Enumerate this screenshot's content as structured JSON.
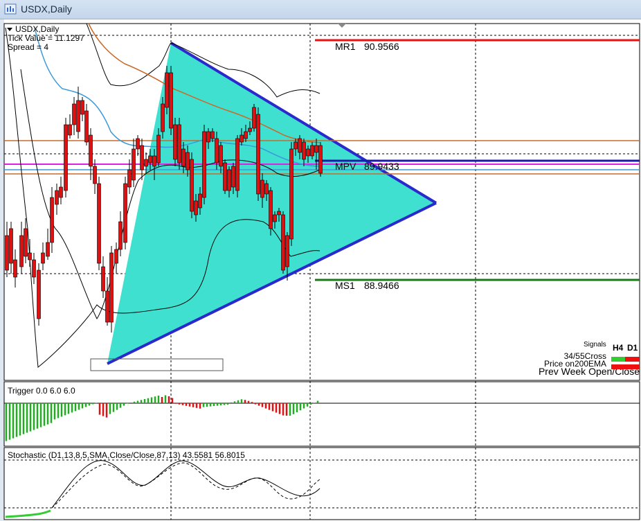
{
  "window": {
    "title": "USDX,Daily",
    "icon": "chart-window-icon"
  },
  "main_panel": {
    "header": {
      "symbol": "USDX,Daily",
      "tick_value": "Tick Value = 11.1297",
      "spread": "Spread = 4",
      "collapse_icon": "triangle-down-icon"
    },
    "levels": [
      {
        "name": "MR1",
        "value": "90.9566",
        "color": "#ee1111"
      },
      {
        "name": "MPV",
        "value": "89.9433",
        "color": "#1a1aa8"
      },
      {
        "name": "MS1",
        "value": "88.9466",
        "color": "#1a7a1a"
      }
    ],
    "signals": {
      "title": "Signals",
      "col_h4": "H4",
      "col_d1": "D1",
      "rows": [
        "34/55Cross",
        "Price on200EMA",
        "Prev Week Open/Close"
      ]
    },
    "colors": {
      "triangle_fill": "#40e0d0",
      "triangle_edge": "#2a2acc",
      "bull_candle": "#22aa22",
      "bear_candle": "#dd1111",
      "ma_orange": "#c86a2a",
      "ma_blue": "#3a9ad9",
      "magenta_line": "#e020e0"
    }
  },
  "trigger_panel": {
    "label": "Trigger 0.0 6.0 6.0"
  },
  "stochastic_panel": {
    "label": "Stochastic (D1,13,8,5,SMA,Close/Close,87,13) 43.5581 56.8015"
  }
}
